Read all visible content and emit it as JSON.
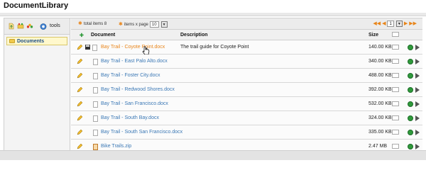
{
  "app_title": "DocumentLibrary",
  "left": {
    "tools_label": "tools",
    "tree_item": "Documents"
  },
  "topbar": {
    "total_items": "total items 8",
    "items_per_page_label": "items x page",
    "items_per_page_value": "10",
    "page_value": "1"
  },
  "columns": {
    "document": "Document",
    "description": "Description",
    "size": "Size"
  },
  "rows": [
    {
      "name": "Bay Trail - Coyote Point.docx",
      "description": "The trail guide for Coyote Point",
      "size": "140.00 KB",
      "highlight": true
    },
    {
      "name": "Bay Trail - East Palo Alto.docx",
      "description": "",
      "size": "340.00 KB"
    },
    {
      "name": "Bay Trail - Foster City.docx",
      "description": "",
      "size": "488.00 KB"
    },
    {
      "name": "Bay Trail - Redwood Shores.docx",
      "description": "",
      "size": "392.00 KB"
    },
    {
      "name": "Bay Trail - San Francisco.docx",
      "description": "",
      "size": "532.00 KB"
    },
    {
      "name": "Bay Trail - South Bay.docx",
      "description": "",
      "size": "324.00 KB"
    },
    {
      "name": "Bay Trail - South San Francisco.docx",
      "description": "",
      "size": "335.00 KB"
    },
    {
      "name": "Bike Trails.zip",
      "description": "",
      "size": "2.47 MB",
      "zip": true
    }
  ],
  "colors": {
    "link": "#3b78b5",
    "link_hover": "#e8851a",
    "status_green": "#2f9a3b"
  }
}
